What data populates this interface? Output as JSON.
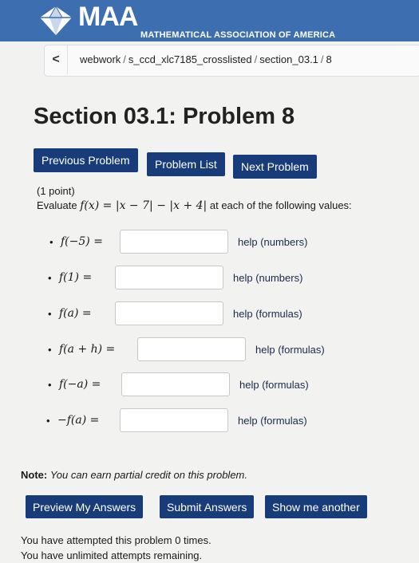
{
  "header": {
    "brand": "MAA",
    "brand_sub": "MATHEMATICAL ASSOCIATION OF AMERICA",
    "logo_icon": "maa-diamond-logo",
    "color": "#3d6fb0"
  },
  "breadcrumb": {
    "back_label": "<",
    "items": [
      "webwork",
      "s_ccd_xlc7185_crosslisted",
      "section_03.1",
      "8"
    ]
  },
  "page_title": "Section 03.1: Problem 8",
  "nav": {
    "previous": "Previous Problem",
    "list": "Problem List",
    "next": "Next Problem"
  },
  "problem": {
    "points": "(1 point)",
    "prompt_start": "Evaluate ",
    "prompt_end": " at each of the following values:",
    "rows": [
      {
        "label": "f(−5) =",
        "value": "",
        "help": "help (numbers)"
      },
      {
        "label": "f(1) =",
        "value": "",
        "help": "help (numbers)"
      },
      {
        "label": "f(a) =",
        "value": "",
        "help": "help (formulas)"
      },
      {
        "label": "f(a + h) =",
        "value": "",
        "help": "help (formulas)"
      },
      {
        "label": "f(−a) =",
        "value": "",
        "help": "help (formulas)"
      },
      {
        "label": "−f(a) =",
        "value": "",
        "help": "help (formulas)"
      }
    ]
  },
  "note": {
    "label": "Note:",
    "text": "You can earn partial credit on this problem."
  },
  "actions": {
    "preview": "Preview My Answers",
    "submit": "Submit Answers",
    "another": "Show me another"
  },
  "status": {
    "attempts": "You have attempted this problem 0 times.",
    "remaining": "You have unlimited attempts remaining."
  },
  "colors": {
    "button": "#183b7a",
    "header": "#3d6fb0"
  }
}
